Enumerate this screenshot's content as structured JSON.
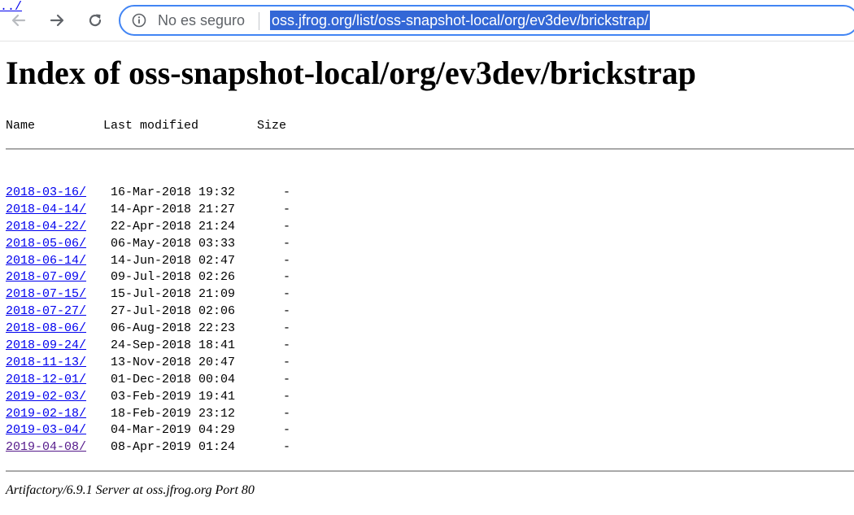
{
  "browser": {
    "security_label": "No es seguro",
    "url": "oss.jfrog.org/list/oss-snapshot-local/org/ev3dev/brickstrap/",
    "back_icon": "arrow-left-icon",
    "forward_icon": "arrow-right-icon",
    "reload_icon": "reload-icon",
    "info_icon": "info-icon",
    "accent_color": "#4285f4",
    "selection_color": "#3367d6"
  },
  "page": {
    "title": "Index of oss-snapshot-local/org/ev3dev/brickstrap",
    "columns": {
      "name": "Name",
      "modified": "Last modified",
      "size": "Size"
    },
    "parent_link": "../",
    "entries": [
      {
        "name": "2018-03-16/",
        "modified": "16-Mar-2018 19:32",
        "size": "-"
      },
      {
        "name": "2018-04-14/",
        "modified": "14-Apr-2018 21:27",
        "size": "-"
      },
      {
        "name": "2018-04-22/",
        "modified": "22-Apr-2018 21:24",
        "size": "-"
      },
      {
        "name": "2018-05-06/",
        "modified": "06-May-2018 03:33",
        "size": "-"
      },
      {
        "name": "2018-06-14/",
        "modified": "14-Jun-2018 02:47",
        "size": "-"
      },
      {
        "name": "2018-07-09/",
        "modified": "09-Jul-2018 02:26",
        "size": "-"
      },
      {
        "name": "2018-07-15/",
        "modified": "15-Jul-2018 21:09",
        "size": "-"
      },
      {
        "name": "2018-07-27/",
        "modified": "27-Jul-2018 02:06",
        "size": "-"
      },
      {
        "name": "2018-08-06/",
        "modified": "06-Aug-2018 22:23",
        "size": "-"
      },
      {
        "name": "2018-09-24/",
        "modified": "24-Sep-2018 18:41",
        "size": "-"
      },
      {
        "name": "2018-11-13/",
        "modified": "13-Nov-2018 20:47",
        "size": "-"
      },
      {
        "name": "2018-12-01/",
        "modified": "01-Dec-2018 00:04",
        "size": "-"
      },
      {
        "name": "2019-02-03/",
        "modified": "03-Feb-2019 19:41",
        "size": "-"
      },
      {
        "name": "2019-02-18/",
        "modified": "18-Feb-2019 23:12",
        "size": "-"
      },
      {
        "name": "2019-03-04/",
        "modified": "04-Mar-2019 04:29",
        "size": "-"
      },
      {
        "name": "2019-04-08/",
        "modified": "08-Apr-2019 01:24",
        "size": "-",
        "visited": true
      }
    ],
    "footer": "Artifactory/6.9.1 Server at oss.jfrog.org Port 80",
    "link_color": "#0000ee",
    "visited_link_color": "#551a8b"
  }
}
